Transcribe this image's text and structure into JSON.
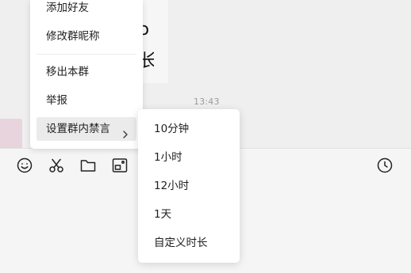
{
  "chat": {
    "timestamp": "13:43",
    "partial_text": "ɔ 长"
  },
  "context_menu": {
    "items": [
      {
        "label": "添加好友"
      },
      {
        "label": "修改群昵称"
      },
      {
        "label": "移出本群"
      },
      {
        "label": "举报"
      },
      {
        "label": "设置群内禁言",
        "has_submenu": true,
        "active": true
      }
    ]
  },
  "mute_submenu": {
    "options": [
      {
        "label": "10分钟"
      },
      {
        "label": "1小时"
      },
      {
        "label": "12小时"
      },
      {
        "label": "1天"
      },
      {
        "label": "自定义时长"
      }
    ]
  },
  "toolbar": {
    "icons": [
      "emoji-icon",
      "scissors-icon",
      "folder-icon",
      "screenshot-icon",
      "history-clock-icon"
    ]
  },
  "colors": {
    "background": "#f1f1f1",
    "menu_bg": "#ffffff",
    "hover_bg": "#ebebeb",
    "text": "#1f1f1f",
    "timestamp": "#9a9a9a"
  }
}
